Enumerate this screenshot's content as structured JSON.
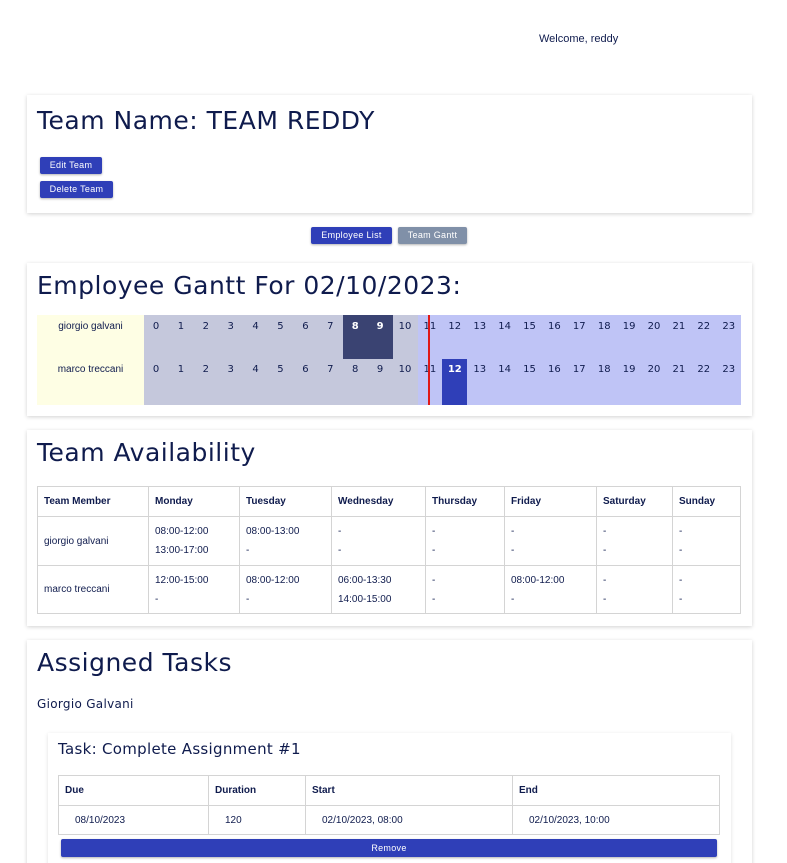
{
  "header": {
    "welcome": "Welcome, reddy"
  },
  "team": {
    "title": "Team Name: TEAM REDDY",
    "edit_label": "Edit Team",
    "delete_label": "Delete Team"
  },
  "view_tabs": {
    "employee_list": "Employee List",
    "team_gantt": "Team Gantt"
  },
  "gantt": {
    "title": "Employee Gantt For 02/10/2023:",
    "hours": [
      "0",
      "1",
      "2",
      "3",
      "4",
      "5",
      "6",
      "7",
      "8",
      "9",
      "10",
      "11",
      "12",
      "13",
      "14",
      "15",
      "16",
      "17",
      "18",
      "19",
      "20",
      "21",
      "22",
      "23"
    ],
    "rows": [
      {
        "name": "giorgio galvani",
        "highlight_hours": [
          "8",
          "9"
        ]
      },
      {
        "name": "marco treccani",
        "highlight_hours": [
          "12"
        ]
      }
    ],
    "colors": {
      "past": "#c5c8dc",
      "future": "#bfc4f6",
      "names_bg": "#fefee4",
      "now_line": "#e01818",
      "past_block": "#3a4372",
      "future_block": "#2f3fb8"
    }
  },
  "availability": {
    "title": "Team Availability",
    "headers": [
      "Team Member",
      "Monday",
      "Tuesday",
      "Wednesday",
      "Thursday",
      "Friday",
      "Saturday",
      "Sunday"
    ],
    "rows": [
      {
        "member": "giorgio galvani",
        "days": [
          [
            "08:00-12:00",
            "13:00-17:00"
          ],
          [
            "08:00-13:00",
            "-"
          ],
          [
            "-",
            "-"
          ],
          [
            "-",
            "-"
          ],
          [
            "-",
            "-"
          ],
          [
            "-",
            "-"
          ],
          [
            "-",
            "-"
          ]
        ]
      },
      {
        "member": "marco treccani",
        "days": [
          [
            "12:00-15:00",
            "-"
          ],
          [
            "08:00-12:00",
            "-"
          ],
          [
            "06:00-13:30",
            "14:00-15:00"
          ],
          [
            "-",
            "-"
          ],
          [
            "08:00-12:00",
            "-"
          ],
          [
            "-",
            "-"
          ],
          [
            "-",
            "-"
          ]
        ]
      }
    ]
  },
  "tasks": {
    "title": "Assigned Tasks",
    "employee": "Giorgio Galvani",
    "task": {
      "title": "Task: Complete Assignment #1",
      "headers": {
        "due": "Due",
        "duration": "Duration",
        "start": "Start",
        "end": "End"
      },
      "values": {
        "due": "08/10/2023",
        "duration": "120",
        "start": "02/10/2023, 08:00",
        "end": "02/10/2023, 10:00"
      },
      "remove_label": "Remove"
    }
  },
  "brand_color": "#2f3fb8",
  "text_color": "#0f1b4d"
}
